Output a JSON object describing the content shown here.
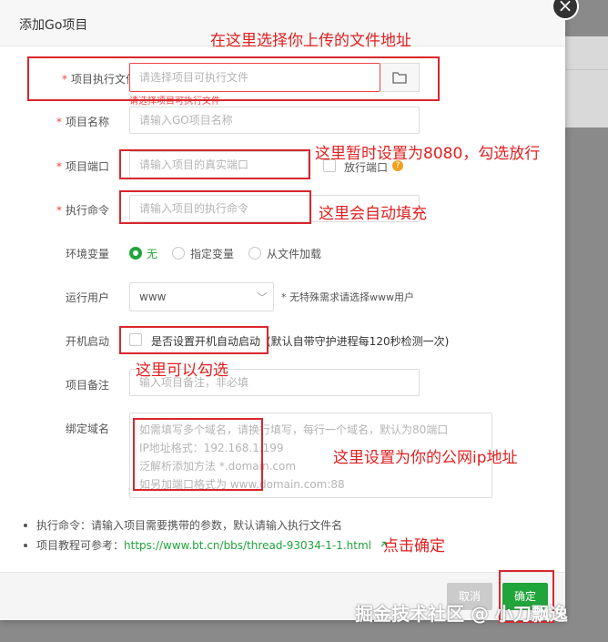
{
  "dialog": {
    "title": "添加Go项目",
    "close_icon": "×"
  },
  "form": {
    "exec_file": {
      "required": "*",
      "label": "项目执行文件",
      "placeholder": "请选择项目可执行文件",
      "error": "请选择项目可执行文件"
    },
    "name": {
      "required": "*",
      "label": "项目名称",
      "placeholder": "请输入GO项目名称"
    },
    "port": {
      "required": "*",
      "label": "项目端口",
      "placeholder": "请输入项目的真实端口",
      "open_port_label": "放行端口",
      "help_icon": "?"
    },
    "command": {
      "required": "*",
      "label": "执行命令",
      "placeholder": "请输入项目的执行命令"
    },
    "env": {
      "label": "环境变量",
      "options": [
        "无",
        "指定变量",
        "从文件加载"
      ],
      "selected": "无"
    },
    "run_user": {
      "label": "运行用户",
      "value": "www",
      "hint": "* 无特殊需求请选择www用户"
    },
    "autostart": {
      "label": "开机启动",
      "checkbox_label": "是否设置开机自动启动",
      "note": "(默认自带守护进程每120秒检测一次)"
    },
    "remark": {
      "label": "项目备注",
      "placeholder": "输入项目备注，非必填"
    },
    "domain": {
      "label": "绑定域名",
      "placeholder_lines": [
        "如需填写多个域名，请换行填写，每行一个域名，默认为80端口",
        "IP地址格式：192.168.1.199",
        "泛解析添加方法 *.domain.com",
        "如另加端口格式为 www.domain.com:88"
      ]
    }
  },
  "tips": {
    "tip1": "执行命令：请输入项目需要携带的参数，默认请输入执行文件名",
    "tip2_prefix": "项目教程可参考：",
    "tip2_link": "https://www.bt.cn/bbs/thread-93034-1-1.html"
  },
  "footer": {
    "cancel_label": "取消",
    "ok_label": "确定"
  },
  "annotations": {
    "a1": "在这里选择你上传的文件地址",
    "a2": "这里暂时设置为8080，勾选放行",
    "a3": "这里会自动填充",
    "a4": "这里可以勾选",
    "a5": "这里设置为你的公网ip地址",
    "a6": "点击确定"
  },
  "watermark": "掘金技术社区 @ 小刀飘逸",
  "colors": {
    "accent": "#20a53a",
    "error": "#ef4444",
    "annotation": "#d9262c"
  }
}
